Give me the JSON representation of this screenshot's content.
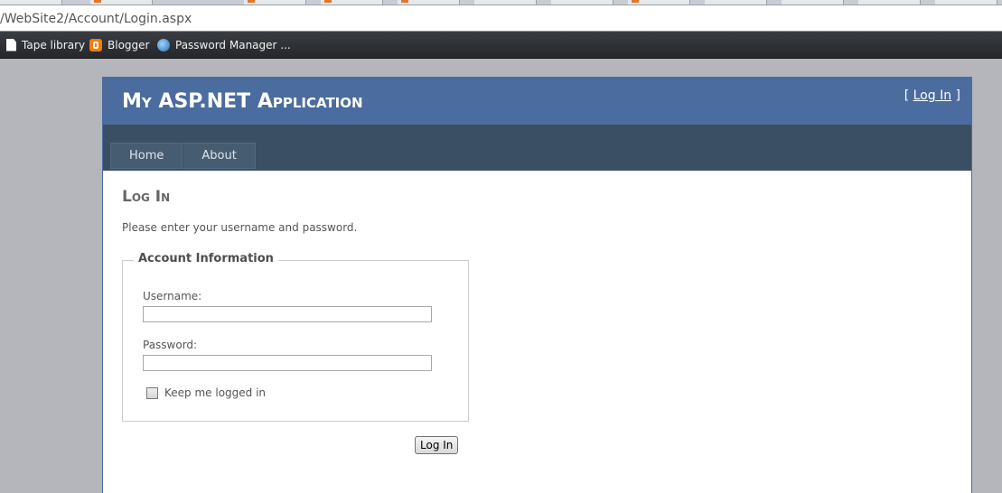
{
  "browser": {
    "url": "/WebSite2/Account/Login.aspx",
    "bookmarks": [
      {
        "label": "Tape library",
        "icon": "document-icon"
      },
      {
        "label": "Blogger",
        "icon": "blogger-icon"
      },
      {
        "label": "Password Manager ...",
        "icon": "password-manager-icon"
      }
    ]
  },
  "site": {
    "title": "My ASP.NET Application",
    "login_open": "[ ",
    "login_link": "Log In",
    "login_close": " ]",
    "menu": [
      "Home",
      "About"
    ]
  },
  "login": {
    "heading": "Log In",
    "intro": "Please enter your username and password.",
    "legend": "Account Information",
    "username_label": "Username:",
    "username_value": "",
    "password_label": "Password:",
    "password_value": "",
    "remember_label": "Keep me logged in",
    "remember_checked": false,
    "submit_label": "Log In"
  },
  "colors": {
    "header": "#4b6c9e",
    "menubar": "#3a4f63",
    "menu_item": "#465c71",
    "outer_background": "#b5b6bb"
  }
}
